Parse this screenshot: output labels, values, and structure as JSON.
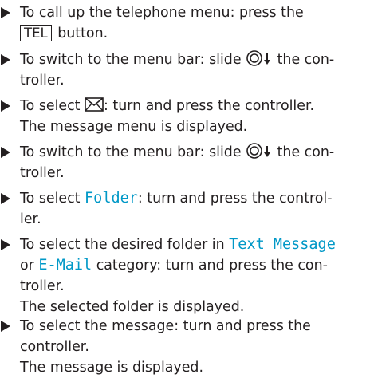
{
  "steps": [
    {
      "l1": "To call up the telephone menu: press the",
      "key": "TEL",
      "l2": "button."
    },
    {
      "l1a": "To switch to the menu bar: slide",
      "controller_icon": "controller-slide-down-icon",
      "l1b": "the con-",
      "l2": "troller."
    },
    {
      "l1a": "To select",
      "envelope_icon": "envelope-icon",
      "l1b": ": turn and press the controller.",
      "result": "The message menu is displayed."
    },
    {
      "l1a": "To switch to the menu bar: slide",
      "controller_icon": "controller-slide-down-icon",
      "l1b": "the con-",
      "l2": "troller."
    },
    {
      "l1a": "To select",
      "item": "Folder",
      "l1b": ": turn and press the control-",
      "l2": "ler."
    },
    {
      "l1a": "To select the desired folder in",
      "item1": "Text Message",
      "l2a": "or",
      "item2": "E-Mail",
      "l2b": "category: turn and press the con-",
      "l3": "troller.",
      "result": "The selected folder is displayed."
    },
    {
      "l1": "To select the message: turn and press the",
      "l2": "controller.",
      "result": "The message is displayed."
    }
  ],
  "colors": {
    "text": "#231f20",
    "display_item": "#0098c7"
  }
}
